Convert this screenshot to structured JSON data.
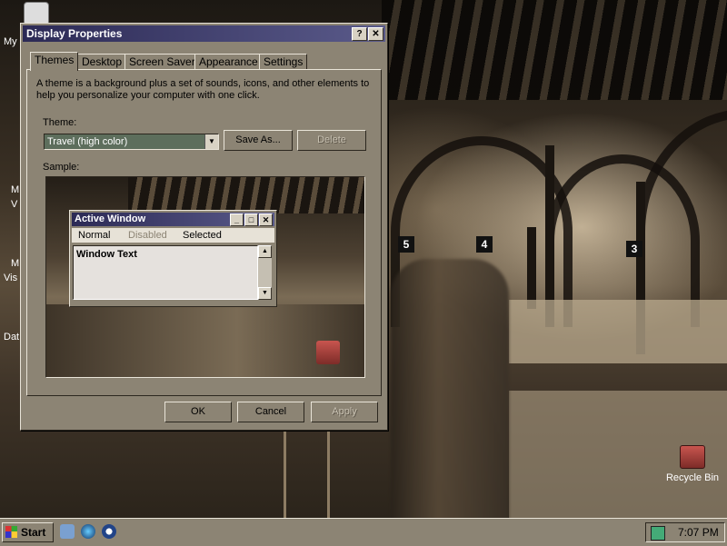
{
  "desktop": {
    "partial_labels": [
      "My",
      "M",
      "V",
      "M",
      "Vis",
      "Dat"
    ],
    "recycle_bin_label": "Recycle Bin",
    "signs": [
      "5",
      "4",
      "3"
    ]
  },
  "dialog": {
    "title": "Display Properties",
    "help_button": "?",
    "close_button": "✕",
    "tabs": [
      "Themes",
      "Desktop",
      "Screen Saver",
      "Appearance",
      "Settings"
    ],
    "active_tab": "Themes",
    "description": "A theme is a background plus a set of sounds, icons, and other elements to help you personalize your computer with one click.",
    "theme_label": "Theme:",
    "theme_value": "Travel (high color)",
    "save_as_label": "Save As...",
    "delete_label": "Delete",
    "sample_label": "Sample:",
    "ok_label": "OK",
    "cancel_label": "Cancel",
    "apply_label": "Apply"
  },
  "sample_window": {
    "title": "Active Window",
    "menu": [
      "Normal",
      "Disabled",
      "Selected"
    ],
    "body_text": "Window Text"
  },
  "taskbar": {
    "start_label": "Start",
    "clock": "7:07 PM"
  },
  "colors": {
    "titlebar": "#2c2a55",
    "face": "#8c8474",
    "combo_bg": "#5d6e5c"
  }
}
